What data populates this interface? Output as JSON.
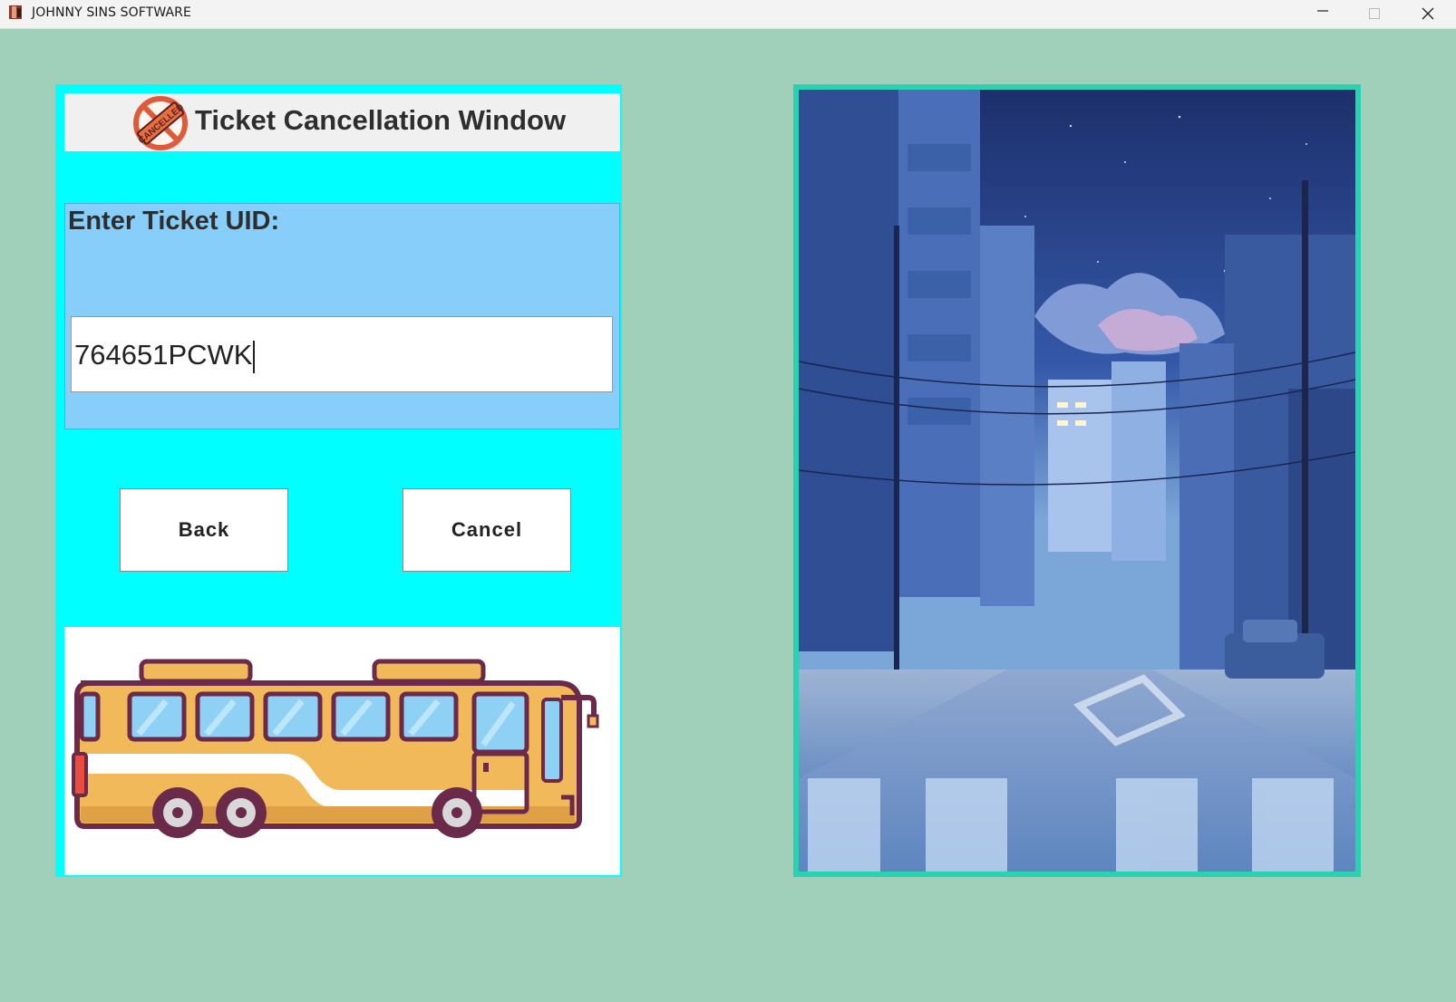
{
  "window": {
    "title": "JOHNNY SINS SOFTWARE",
    "icon": "app-icon",
    "controls": [
      "minimize-icon",
      "maximize-icon",
      "close-icon"
    ]
  },
  "header": {
    "title": "Ticket Cancellation Window",
    "stamp_text": "CANCELLED",
    "icon": "cancelled-stamp-icon"
  },
  "form": {
    "uid_label": "Enter Ticket UID:",
    "uid_value": "764651PCWK"
  },
  "buttons": {
    "back_label": "Back",
    "cancel_label": "Cancel"
  },
  "images": {
    "bus": "bus-illustration",
    "street": "night-street-illustration"
  },
  "colors": {
    "background": "#a0cfba",
    "panel": "#00ffff",
    "uid_box": "#87cefa",
    "image_border": "#29d3b2",
    "bus_body": "#f2b95a",
    "bus_outline": "#6b2a4a"
  }
}
